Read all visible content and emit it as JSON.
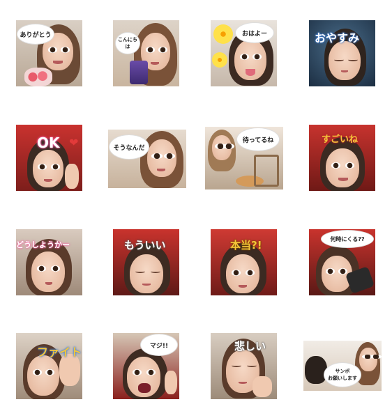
{
  "stickers": [
    {
      "text": "ありがとう"
    },
    {
      "text": "こんにちは"
    },
    {
      "text": "おはよー"
    },
    {
      "text": "おやすみ"
    },
    {
      "text": "OK"
    },
    {
      "text": "そうなんだ"
    },
    {
      "text": "待ってるね"
    },
    {
      "text": "すごいね"
    },
    {
      "text": "どうしようかー"
    },
    {
      "text": "もういい"
    },
    {
      "text": "本当?!"
    },
    {
      "text": "何時にくる??"
    },
    {
      "text": "ファイト"
    },
    {
      "text": "マジ!!"
    },
    {
      "text": "悲しい"
    },
    {
      "text": "サンポ\nお願いします"
    }
  ],
  "colors": {
    "pink": "#ff5fa8",
    "gold": "#f5c63a",
    "red": "#e23a3a",
    "blue": "#3a7bd5",
    "dark_red": "#b8202a"
  }
}
